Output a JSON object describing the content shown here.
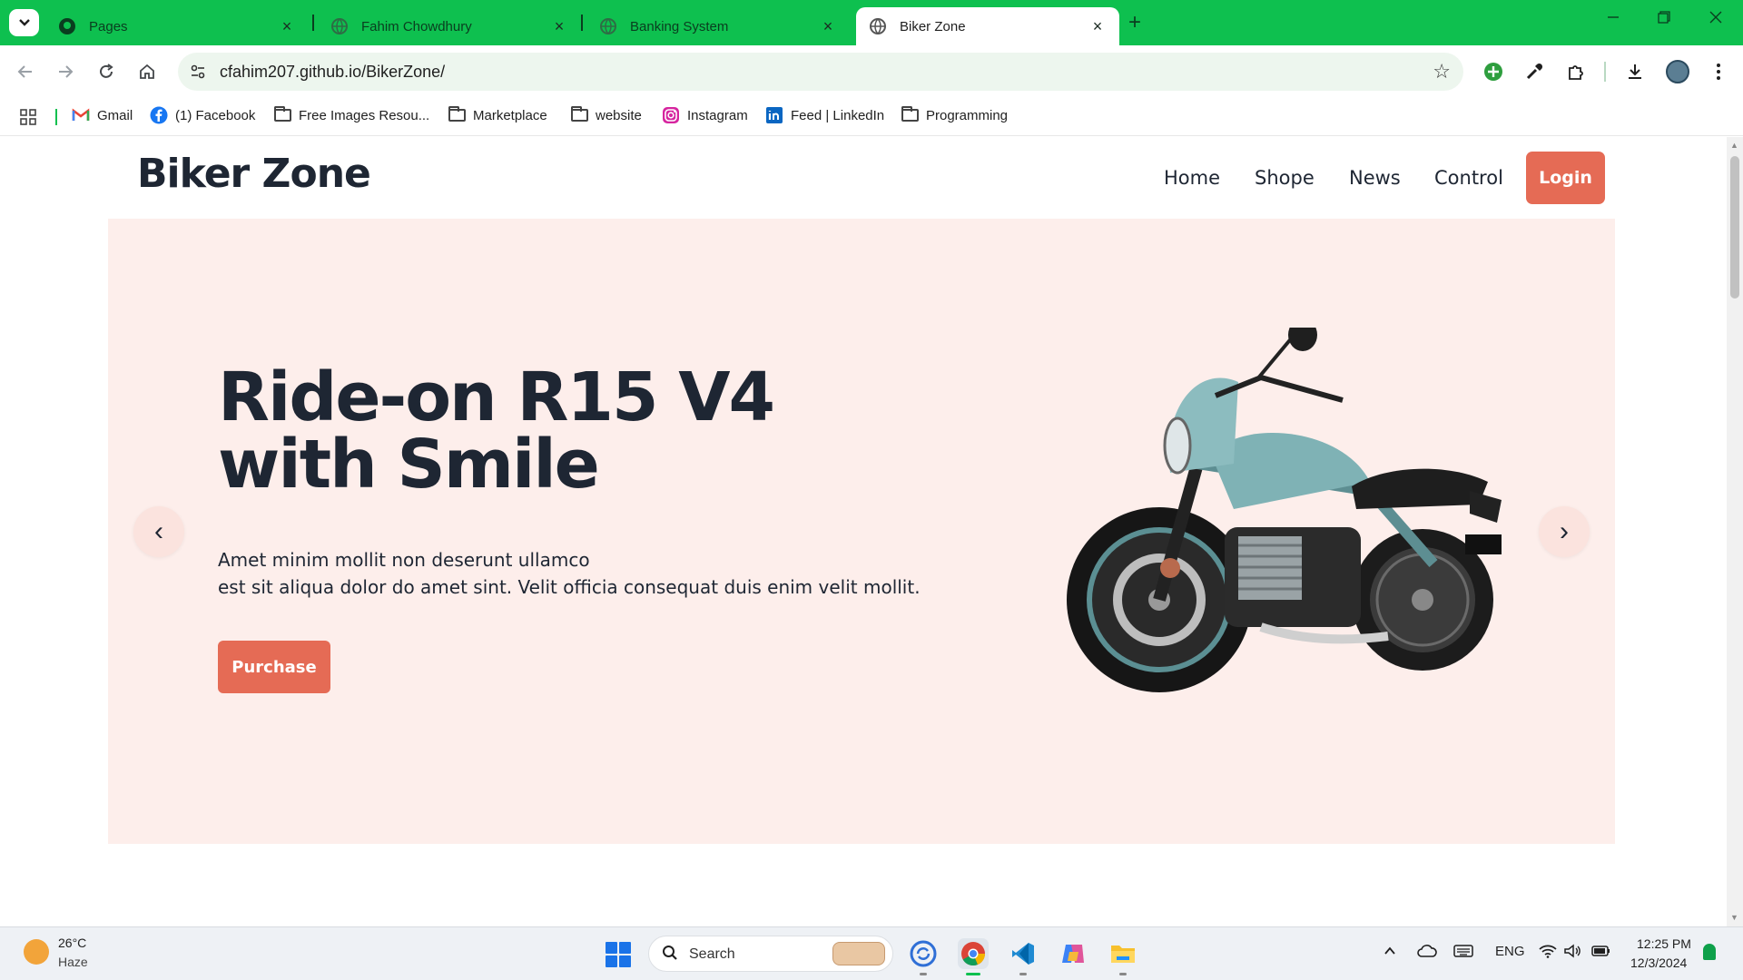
{
  "browser": {
    "tabs": [
      {
        "title": "Pages",
        "icon": "github-icon",
        "active": false
      },
      {
        "title": "Fahim Chowdhury",
        "icon": "globe-icon",
        "active": false
      },
      {
        "title": "Banking System",
        "icon": "globe-icon",
        "active": false
      },
      {
        "title": "Biker Zone",
        "icon": "globe-icon",
        "active": true
      }
    ],
    "tab_close": "×",
    "new_tab": "+",
    "url": "cfahim207.github.io/BikerZone/",
    "bookmarks": [
      {
        "label": "Gmail",
        "icon": "gmail-icon"
      },
      {
        "label": "(1) Facebook",
        "icon": "facebook-icon"
      },
      {
        "label": "Free Images Resou...",
        "icon": "folder-icon"
      },
      {
        "label": "Marketplace",
        "icon": "folder-icon"
      },
      {
        "label": "website",
        "icon": "folder-icon"
      },
      {
        "label": "Instagram",
        "icon": "instagram-icon"
      },
      {
        "label": "Feed | LinkedIn",
        "icon": "linkedin-icon"
      },
      {
        "label": "Programming",
        "icon": "folder-icon"
      }
    ],
    "accent_color": "#0ec04f"
  },
  "page": {
    "brand": "Biker Zone",
    "nav": [
      "Home",
      "Shope",
      "News",
      "Control"
    ],
    "login_label": "Login",
    "hero": {
      "title_line1": "Ride-on R15 V4",
      "title_line2": "with Smile",
      "desc_line1": "Amet minim mollit non deserunt ullamco",
      "desc_line2": "est sit aliqua dolor do amet sint. Velit officia consequat duis enim velit mollit.",
      "purchase_label": "Purchase",
      "prev_arrow": "‹",
      "next_arrow": "›"
    },
    "colors": {
      "primary": "#e56b55",
      "hero_bg": "#fdeeeb",
      "text": "#1e2633"
    }
  },
  "taskbar": {
    "weather_temp": "26°C",
    "weather_cond": "Haze",
    "search_label": "Search",
    "lang": "ENG",
    "time": "12:25 PM",
    "date": "12/3/2024"
  }
}
